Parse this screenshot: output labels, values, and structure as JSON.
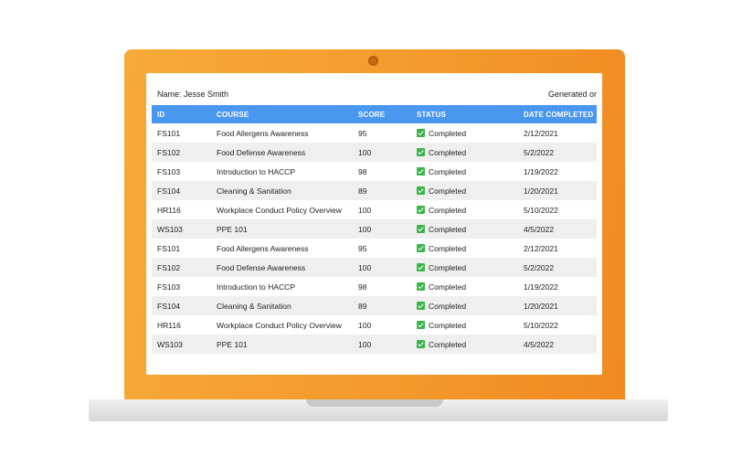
{
  "report": {
    "name_label": "Name: Jesse Smith",
    "generated_label": "Generated or"
  },
  "table": {
    "headers": [
      "ID",
      "COURSE",
      "SCORE",
      "STATUS",
      "DATE COMPLETED"
    ],
    "rows": [
      {
        "id": "FS101",
        "course": "Food Allergens Awareness",
        "score": "95",
        "status": "Completed",
        "date": "2/12/2021"
      },
      {
        "id": "FS102",
        "course": "Food Defense Awareness",
        "score": "100",
        "status": "Completed",
        "date": "5/2/2022"
      },
      {
        "id": "FS103",
        "course": "Introduction to HACCP",
        "score": "98",
        "status": "Completed",
        "date": "1/19/2022"
      },
      {
        "id": "FS104",
        "course": "Cleaning & Sanitation",
        "score": "89",
        "status": "Completed",
        "date": "1/20/2021"
      },
      {
        "id": "HR116",
        "course": "Workplace Conduct Policy Overview",
        "score": "100",
        "status": "Completed",
        "date": "5/10/2022"
      },
      {
        "id": "WS103",
        "course": "PPE 101",
        "score": "100",
        "status": "Completed",
        "date": "4/5/2022"
      },
      {
        "id": "FS101",
        "course": "Food Allergens Awareness",
        "score": "95",
        "status": "Completed",
        "date": "2/12/2021"
      },
      {
        "id": "FS102",
        "course": "Food Defense Awareness",
        "score": "100",
        "status": "Completed",
        "date": "5/2/2022"
      },
      {
        "id": "FS103",
        "course": "Introduction to HACCP",
        "score": "98",
        "status": "Completed",
        "date": "1/19/2022"
      },
      {
        "id": "FS104",
        "course": "Cleaning & Sanitation",
        "score": "89",
        "status": "Completed",
        "date": "1/20/2021"
      },
      {
        "id": "HR116",
        "course": "Workplace Conduct Policy Overview",
        "score": "100",
        "status": "Completed",
        "date": "5/10/2022"
      },
      {
        "id": "WS103",
        "course": "PPE 101",
        "score": "100",
        "status": "Completed",
        "date": "4/5/2022"
      }
    ]
  },
  "colors": {
    "laptop_frame": "#f49a2c",
    "header_bg": "#4a97f0",
    "status_check": "#3bb44a",
    "row_stripe": "#efefef"
  },
  "icons": {
    "status": "check-icon",
    "camera": "camera-icon"
  }
}
